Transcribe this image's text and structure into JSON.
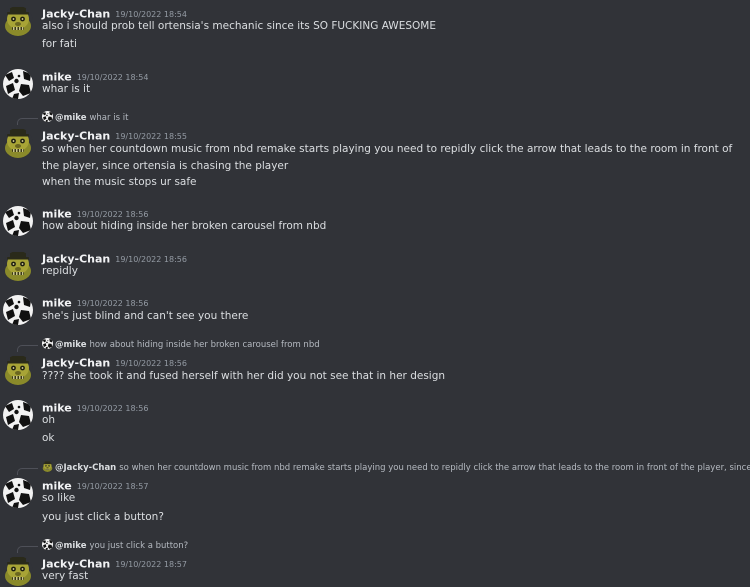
{
  "messages": [
    {
      "author": "Jacky-Chan",
      "time": "19/10/2022 18:54",
      "lines": [
        "also i should prob tell ortensia's mechanic since its SO FUCKING AWESOME",
        "for fati"
      ]
    },
    {
      "author": "mike",
      "time": "19/10/2022 18:54",
      "lines": [
        "whar is it"
      ]
    },
    {
      "reply": {
        "author": "@mike",
        "text": "whar is it"
      },
      "author": "Jacky-Chan",
      "time": "19/10/2022 18:55",
      "lines": [
        "so when her countdown music from nbd remake starts playing you need to repidly click the arrow that leads to the room in front of the player, since ortensia is chasing the player",
        "when the music stops ur safe"
      ]
    },
    {
      "author": "mike",
      "time": "19/10/2022 18:56",
      "lines": [
        "how about hiding inside her broken carousel from nbd"
      ]
    },
    {
      "author": "Jacky-Chan",
      "time": "19/10/2022 18:56",
      "lines": [
        "repidly"
      ]
    },
    {
      "author": "mike",
      "time": "19/10/2022 18:56",
      "lines": [
        "she's just blind and can't see you there"
      ]
    },
    {
      "reply": {
        "author": "@mike",
        "text": "how about hiding inside her broken carousel from nbd"
      },
      "author": "Jacky-Chan",
      "time": "19/10/2022 18:56",
      "lines": [
        "???? she took it and fused herself with her did you not see that in her design"
      ]
    },
    {
      "author": "mike",
      "time": "19/10/2022 18:56",
      "lines": [
        "oh",
        "ok"
      ]
    },
    {
      "reply": {
        "author": "@Jacky-Chan",
        "text": "so when her countdown music from nbd remake starts playing you need to repidly click the arrow that leads to the room in front of the player, since ortensia"
      },
      "author": "mike",
      "time": "19/10/2022 18:57",
      "lines": [
        "so like",
        "you just click a button?"
      ]
    },
    {
      "reply": {
        "author": "@mike",
        "text": "you just click a button?"
      },
      "author": "Jacky-Chan",
      "time": "19/10/2022 18:57",
      "lines": [
        "very fast"
      ]
    }
  ]
}
